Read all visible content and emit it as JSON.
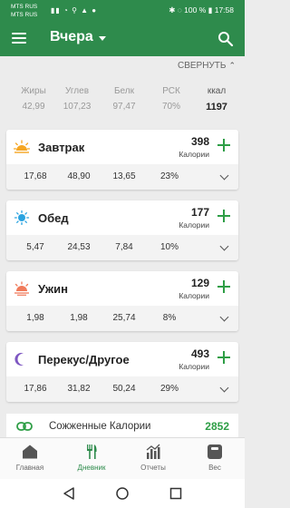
{
  "status_bar": {
    "carrier_1": "MTS RUS",
    "carrier_2": "MTS RUS",
    "battery": "100 %",
    "time": "17:58"
  },
  "app_bar": {
    "title": "Вчера"
  },
  "collapse_label": "СВЕРНУТЬ",
  "summary": {
    "columns": [
      {
        "label": "Жиры",
        "value": "42,99"
      },
      {
        "label": "Углев",
        "value": "107,23"
      },
      {
        "label": "Белк",
        "value": "97,47"
      },
      {
        "label": "РСК",
        "value": "70%"
      },
      {
        "label": "ккал",
        "value": "1197"
      }
    ]
  },
  "meals": [
    {
      "name": "Завтрак",
      "calories": "398",
      "unit": "Калории",
      "fat": "17,68",
      "carbs": "48,90",
      "protein": "13,65",
      "rsk": "23%",
      "icon": "sunrise-icon"
    },
    {
      "name": "Обед",
      "calories": "177",
      "unit": "Калории",
      "fat": "5,47",
      "carbs": "24,53",
      "protein": "7,84",
      "rsk": "10%",
      "icon": "sun-icon"
    },
    {
      "name": "Ужин",
      "calories": "129",
      "unit": "Калории",
      "fat": "1,98",
      "carbs": "1,98",
      "protein": "25,74",
      "rsk": "8%",
      "icon": "sunset-icon"
    },
    {
      "name": "Перекус/Другое",
      "calories": "493",
      "unit": "Калории",
      "fat": "17,86",
      "carbs": "31,82",
      "protein": "50,24",
      "rsk": "29%",
      "icon": "moon-icon"
    }
  ],
  "burned": {
    "label": "Сожженные Калории",
    "value": "2852"
  },
  "bottom_nav": [
    {
      "label": "Главная",
      "icon": "home-icon"
    },
    {
      "label": "Дневник",
      "icon": "cutlery-icon"
    },
    {
      "label": "Отчеты",
      "icon": "chart-icon"
    },
    {
      "label": "Вес",
      "icon": "scale-icon"
    }
  ],
  "colors": {
    "primary": "#2e8b4c",
    "accent_green": "#2e9e46",
    "sun_orange": "#f5a623",
    "sun_blue": "#2aa3e0",
    "sunset": "#f07a5a",
    "moon": "#7e57c2"
  }
}
